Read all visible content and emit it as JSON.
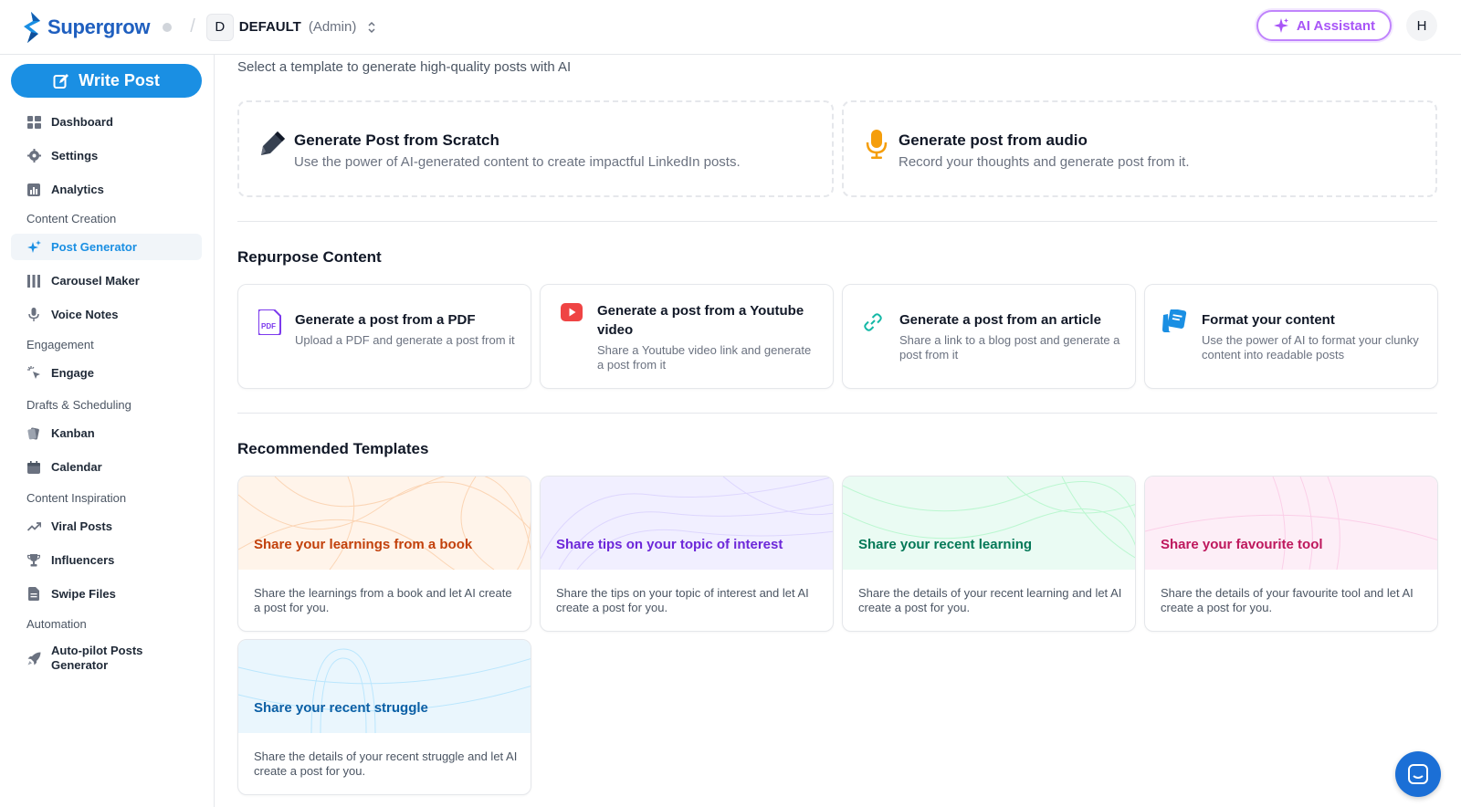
{
  "header": {
    "brand": "Supergrow",
    "separator": "/",
    "workspace_initial": "D",
    "workspace_name": "DEFAULT",
    "workspace_role": "(Admin)",
    "ai_assistant_label": "AI Assistant",
    "user_initial": "H"
  },
  "sidebar": {
    "write_post_label": "Write Post",
    "items": [
      {
        "label": "Dashboard"
      },
      {
        "label": "Settings"
      },
      {
        "label": "Analytics"
      },
      {
        "label": "Post Generator"
      },
      {
        "label": "Carousel Maker"
      },
      {
        "label": "Voice Notes"
      },
      {
        "label": "Engage"
      },
      {
        "label": "Kanban"
      },
      {
        "label": "Calendar"
      },
      {
        "label": "Viral Posts"
      },
      {
        "label": "Influencers"
      },
      {
        "label": "Swipe Files"
      },
      {
        "label": "Auto-pilot Posts Generator"
      }
    ],
    "sections": [
      "Content Creation",
      "Engagement",
      "Drafts & Scheduling",
      "Content Inspiration",
      "Automation"
    ],
    "active_item": "Post Generator"
  },
  "main": {
    "subtitle": "Select a template to generate high-quality posts with AI",
    "primary_cards": [
      {
        "title": "Generate Post from Scratch",
        "desc": "Use the power of AI-generated content to create impactful LinkedIn posts."
      },
      {
        "title": "Generate post from audio",
        "desc": "Record your thoughts and generate post from it."
      }
    ],
    "repurpose_title": "Repurpose Content",
    "repurpose_cards": [
      {
        "title": "Generate a post from a PDF",
        "desc": "Upload a PDF and generate a post from it"
      },
      {
        "title": "Generate a post from a Youtube video",
        "desc": "Share a Youtube video link and generate a post from it"
      },
      {
        "title": "Generate a post from an article",
        "desc": "Share a link to a blog post and generate a post from it"
      },
      {
        "title": "Format your content",
        "desc": "Use the power of AI to format your clunky content into readable posts"
      }
    ],
    "recommended_title": "Recommended Templates",
    "templates": [
      {
        "title": "Share your learnings from a book",
        "desc": "Share the learnings from a book and let AI create a post for you.",
        "color": "#c2410c",
        "bg": "#fff4ea"
      },
      {
        "title": "Share tips on your topic of interest",
        "desc": "Share the tips on your topic of interest and let AI create a post for you.",
        "color": "#6d28d9",
        "bg": "#f1efff"
      },
      {
        "title": "Share your recent learning",
        "desc": "Share the details of your recent learning and let AI create a post for you.",
        "color": "#047857",
        "bg": "#eafbf3"
      },
      {
        "title": "Share your favourite tool",
        "desc": "Share the details of your favourite tool and let AI create a post for you.",
        "color": "#be185d",
        "bg": "#fdeef7"
      },
      {
        "title": "Share your recent struggle",
        "desc": "Share the details of your recent struggle and let AI create a post for you.",
        "color": "#0b5fa5",
        "bg": "#eaf6fd"
      }
    ]
  },
  "colors": {
    "accent": "#1a8fe3",
    "ai_purple": "#a855f7",
    "border": "#e5e7eb"
  }
}
